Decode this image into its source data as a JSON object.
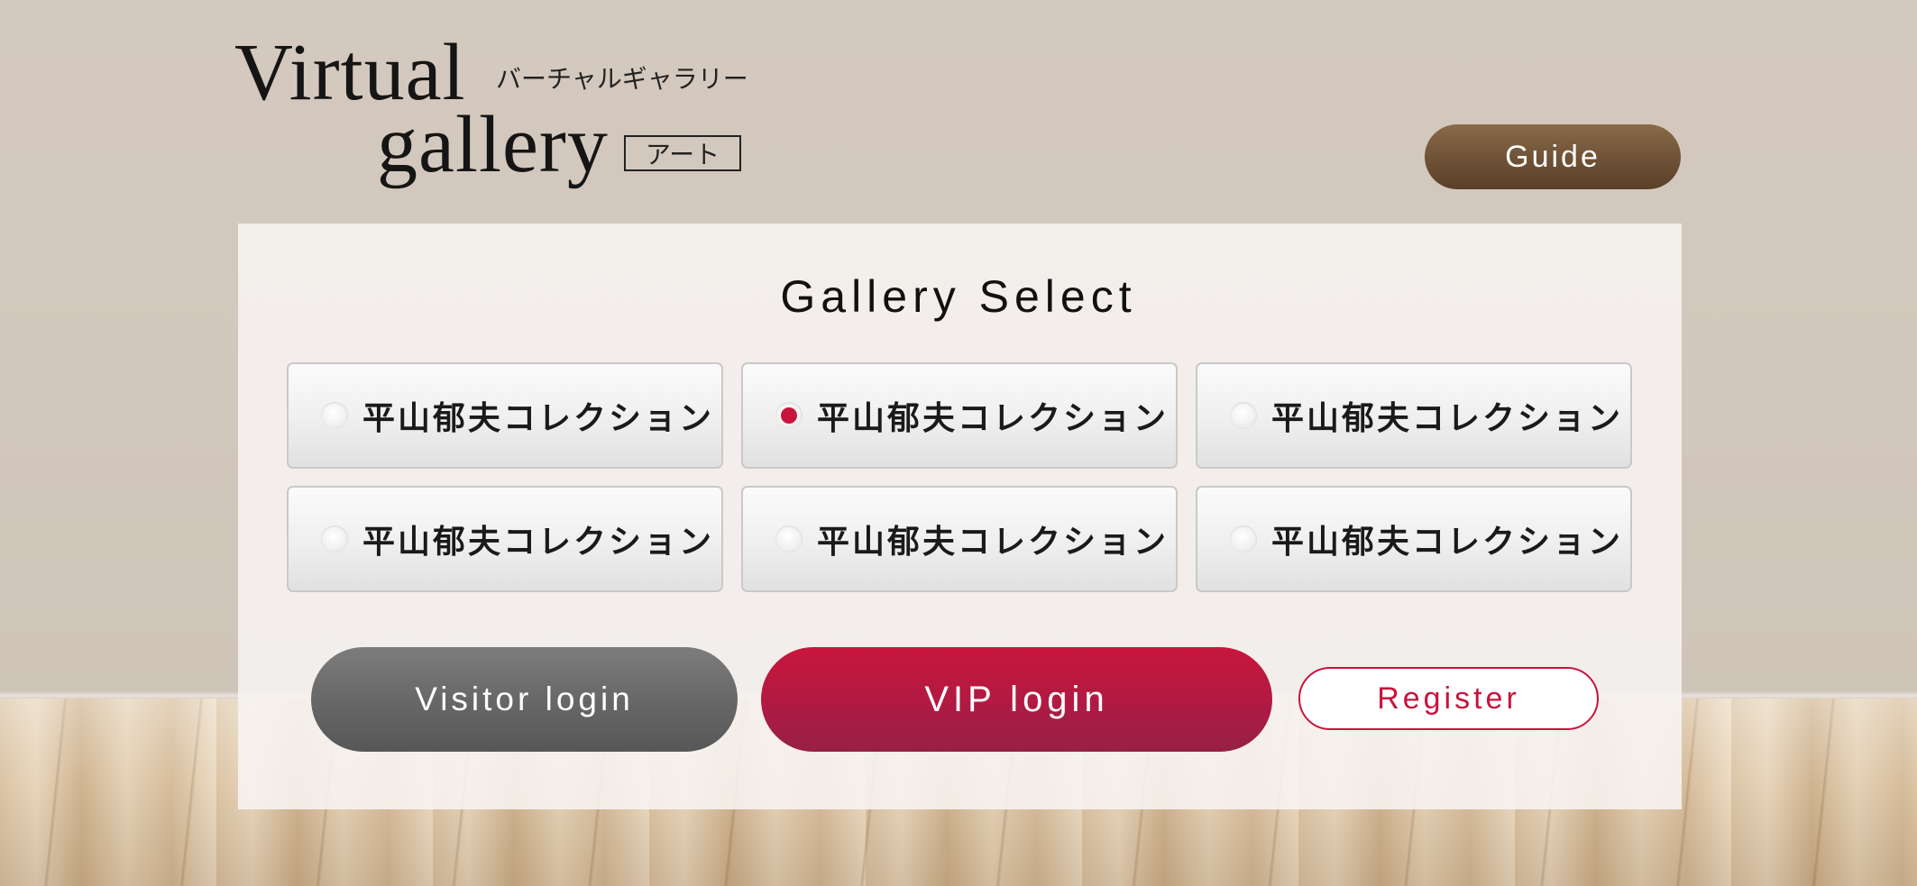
{
  "logo": {
    "title_line1": "Virtual",
    "title_line2": "gallery",
    "subtitle_jp": "バーチャルギャラリー",
    "tag": "アート"
  },
  "header": {
    "guide_label": "Guide"
  },
  "gallery_select": {
    "title": "Gallery Select",
    "selected_index": 1,
    "accent_color": "#c8143c",
    "options": [
      {
        "label": "平山郁夫コレクション",
        "selected": false
      },
      {
        "label": "平山郁夫コレクション",
        "selected": true
      },
      {
        "label": "平山郁夫コレクション",
        "selected": false
      },
      {
        "label": "平山郁夫コレクション",
        "selected": false
      },
      {
        "label": "平山郁夫コレクション",
        "selected": false
      },
      {
        "label": "平山郁夫コレクション",
        "selected": false
      }
    ]
  },
  "actions": {
    "visitor_login_label": "Visitor login",
    "vip_login_label": "VIP login",
    "register_label": "Register"
  },
  "colors": {
    "wall": "#d3c8bd",
    "guide_button": "#6e5236",
    "visitor_button": "#666666",
    "vip_button": "#b01a42",
    "register_border": "#c8143c"
  }
}
